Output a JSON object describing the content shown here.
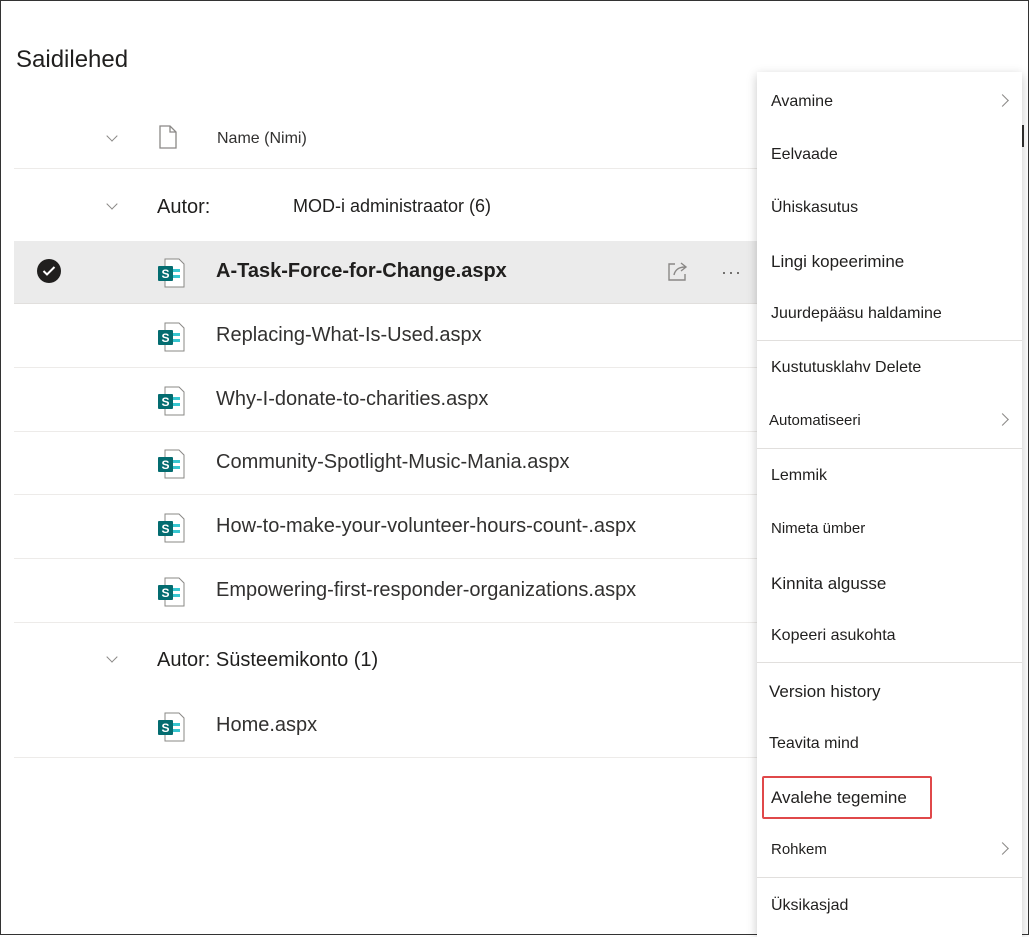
{
  "page": {
    "title": "Saidilehed"
  },
  "columns": {
    "name_label": "Name (Nimi)"
  },
  "groups": [
    {
      "label": "Autor:",
      "value": "MOD-i administraator (6)"
    },
    {
      "label": "Autor: Süsteemikonto (1)"
    }
  ],
  "files": [
    {
      "name": "A-Task-Force-for-Change.aspx",
      "selected": true
    },
    {
      "name": "Replacing-What-Is-Used.aspx"
    },
    {
      "name": "Why-I-donate-to-charities.aspx"
    },
    {
      "name": "Community-Spotlight-Music-Mania.aspx"
    },
    {
      "name": "How-to-make-your-volunteer-hours-count-.aspx"
    },
    {
      "name": "Empowering-first-responder-organizations.aspx"
    },
    {
      "name": "Home.aspx"
    }
  ],
  "row_actions": {
    "more": "···"
  },
  "menu": {
    "items": [
      {
        "label": "Avamine",
        "submenu": true
      },
      {
        "label": "Eelvaade"
      },
      {
        "label": "Ühiskasutus"
      },
      {
        "label": "Lingi kopeerimine"
      },
      {
        "label": "Juurdepääsu haldamine"
      },
      {
        "label": "Kustutusklahv Delete"
      },
      {
        "label": "Automatiseeri",
        "submenu": true
      },
      {
        "label": "Lemmik"
      },
      {
        "label": "Nimeta ümber"
      },
      {
        "label": "Kinnita algusse"
      },
      {
        "label": "Kopeeri asukohta"
      },
      {
        "label": "Version history"
      },
      {
        "label": "Teavita mind"
      },
      {
        "label": "Avalehe tegemine",
        "highlighted": true
      },
      {
        "label": "Rohkem",
        "submenu": true
      },
      {
        "label": "Üksikasjad"
      }
    ]
  },
  "colors": {
    "sharepoint": "#036c70",
    "sharepoint_light": "#37c6d0",
    "highlight": "#e0484a"
  }
}
